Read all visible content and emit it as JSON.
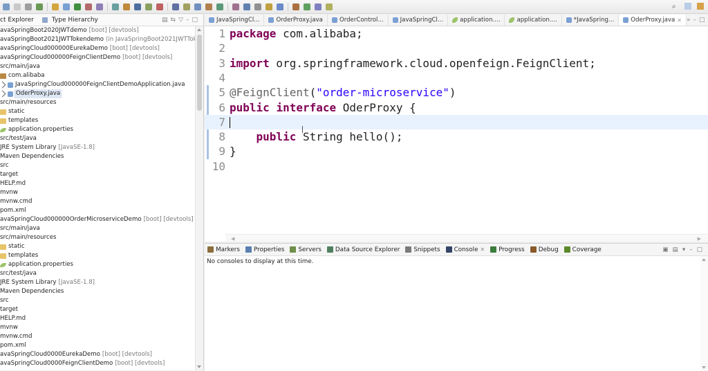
{
  "left_panel": {
    "tabs": [
      "ct Explorer",
      "Type Hierarchy"
    ],
    "tree": [
      {
        "label": "avaSpringBoot2020JWTdemo",
        "muted": "[boot] [devtools]",
        "icon": "none"
      },
      {
        "label": "avaSpringBoot2021JWTTokendemo",
        "muted": "(in JavaSpringBoot2021JWTToken",
        "icon": "none"
      },
      {
        "label": "avaSpringCloud000000EurekaDemo",
        "muted": "[boot] [devtools]",
        "icon": "none"
      },
      {
        "label": "avaSpringCloud000000FeignClientDemo",
        "muted": "[boot] [devtools]",
        "icon": "none"
      },
      {
        "label": "src/main/java",
        "muted": "",
        "icon": "none"
      },
      {
        "label": "com.alibaba",
        "muted": "",
        "icon": "package"
      },
      {
        "label": "JavaSpringCloud000000FeignClientDemoApplication.java",
        "muted": "",
        "icon": "java"
      },
      {
        "label": "OderProxy.java",
        "muted": "",
        "icon": "java",
        "selected": true
      },
      {
        "label": "src/main/resources",
        "muted": "",
        "icon": "none"
      },
      {
        "label": "static",
        "muted": "",
        "icon": "folder"
      },
      {
        "label": "templates",
        "muted": "",
        "icon": "folder"
      },
      {
        "label": "application.properties",
        "muted": "",
        "icon": "leaf"
      },
      {
        "label": "src/test/java",
        "muted": "",
        "icon": "none"
      },
      {
        "label": "JRE System Library",
        "muted": "[JavaSE-1.8]",
        "icon": "none"
      },
      {
        "label": "Maven Dependencies",
        "muted": "",
        "icon": "none"
      },
      {
        "label": "src",
        "muted": "",
        "icon": "none"
      },
      {
        "label": "target",
        "muted": "",
        "icon": "none"
      },
      {
        "label": "HELP.md",
        "muted": "",
        "icon": "none"
      },
      {
        "label": "mvnw",
        "muted": "",
        "icon": "none"
      },
      {
        "label": "mvnw.cmd",
        "muted": "",
        "icon": "none"
      },
      {
        "label": "pom.xml",
        "muted": "",
        "icon": "none"
      },
      {
        "label": "avaSpringCloud000000OrderMicroserviceDemo",
        "muted": "[boot] [devtools]",
        "icon": "none"
      },
      {
        "label": "src/main/java",
        "muted": "",
        "icon": "none"
      },
      {
        "label": "src/main/resources",
        "muted": "",
        "icon": "none"
      },
      {
        "label": "static",
        "muted": "",
        "icon": "folder"
      },
      {
        "label": "templates",
        "muted": "",
        "icon": "folder"
      },
      {
        "label": "application.properties",
        "muted": "",
        "icon": "leaf"
      },
      {
        "label": "src/test/java",
        "muted": "",
        "icon": "none"
      },
      {
        "label": "JRE System Library",
        "muted": "[JavaSE-1.8]",
        "icon": "none"
      },
      {
        "label": "Maven Dependencies",
        "muted": "",
        "icon": "none"
      },
      {
        "label": "src",
        "muted": "",
        "icon": "none"
      },
      {
        "label": "target",
        "muted": "",
        "icon": "none"
      },
      {
        "label": "HELP.md",
        "muted": "",
        "icon": "none"
      },
      {
        "label": "mvnw",
        "muted": "",
        "icon": "none"
      },
      {
        "label": "mvnw.cmd",
        "muted": "",
        "icon": "none"
      },
      {
        "label": "pom.xml",
        "muted": "",
        "icon": "none"
      },
      {
        "label": "avaSpringCloud0000EurekaDemo",
        "muted": "[boot] [devtools]",
        "icon": "none"
      },
      {
        "label": "avaSpringCloud0000FeignClientDemo",
        "muted": "[boot] [devtools]",
        "icon": "none"
      }
    ]
  },
  "editor_tabs": [
    {
      "label": "JavaSpringCl...",
      "icon": "java",
      "active": false
    },
    {
      "label": "OrderProxy.java",
      "icon": "java",
      "active": false
    },
    {
      "label": "OrderControl...",
      "icon": "java",
      "active": false
    },
    {
      "label": "JavaSpringCl...",
      "icon": "java",
      "active": false
    },
    {
      "label": "application....",
      "icon": "props",
      "active": false
    },
    {
      "label": "application....",
      "icon": "props",
      "active": false
    },
    {
      "label": "*JavaSpring...",
      "icon": "java",
      "active": false
    },
    {
      "label": "OderProxy.java",
      "icon": "java",
      "active": true
    }
  ],
  "code": [
    {
      "n": "1",
      "tokens": [
        {
          "t": "kw",
          "v": "package"
        },
        {
          "t": "",
          "v": " com.alibaba;"
        }
      ]
    },
    {
      "n": "2",
      "tokens": []
    },
    {
      "n": "3",
      "tokens": [
        {
          "t": "kw",
          "v": "import"
        },
        {
          "t": "",
          "v": " org.springframework.cloud.openfeign.FeignClient;"
        }
      ]
    },
    {
      "n": "4",
      "tokens": []
    },
    {
      "n": "5",
      "tokens": [
        {
          "t": "ann",
          "v": "@FeignClient"
        },
        {
          "t": "",
          "v": "("
        },
        {
          "t": "str",
          "v": "\"order-microservice\""
        },
        {
          "t": "",
          "v": ")"
        }
      ]
    },
    {
      "n": "6",
      "tokens": [
        {
          "t": "kw",
          "v": "public"
        },
        {
          "t": "",
          "v": " "
        },
        {
          "t": "kw",
          "v": "interface"
        },
        {
          "t": "",
          "v": " OderProxy {"
        }
      ]
    },
    {
      "n": "7",
      "tokens": [],
      "current": true
    },
    {
      "n": "8",
      "tokens": [
        {
          "t": "",
          "v": "    "
        },
        {
          "t": "kw",
          "v": "public"
        },
        {
          "t": "",
          "v": " String hello();"
        }
      ]
    },
    {
      "n": "9",
      "tokens": [
        {
          "t": "",
          "v": "}"
        }
      ]
    },
    {
      "n": "10",
      "tokens": []
    }
  ],
  "bottom_panel": {
    "tabs": [
      {
        "label": "Markers",
        "color": "#8a6d3b"
      },
      {
        "label": "Properties",
        "color": "#5b7fb0"
      },
      {
        "label": "Servers",
        "color": "#6f8f4a"
      },
      {
        "label": "Data Source Explorer",
        "color": "#4f7f5f"
      },
      {
        "label": "Snippets",
        "color": "#7a7a7a"
      },
      {
        "label": "Console",
        "color": "#334466",
        "closable": true
      },
      {
        "label": "Progress",
        "color": "#3c7c3c"
      },
      {
        "label": "Debug",
        "color": "#8a5a2a"
      },
      {
        "label": "Coverage",
        "color": "#5a8a2a"
      }
    ],
    "console_message": "No consoles to display at this time."
  }
}
